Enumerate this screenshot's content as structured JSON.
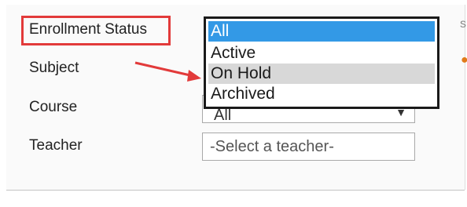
{
  "form": {
    "enrollment_status_label": "Enrollment Status",
    "subject_label": "Subject",
    "course_label": "Course",
    "teacher_label": "Teacher",
    "course_select_value": "All",
    "teacher_placeholder": "-Select a teacher-"
  },
  "dropdown": {
    "options": [
      "All",
      "Active",
      "On Hold",
      "Archived"
    ],
    "selected": "All",
    "hovered": "On Hold"
  },
  "annotation": {
    "highlight_color": "#e23a3a",
    "arrow_color": "#e23a3a"
  },
  "colors": {
    "selected_bg": "#3399e6",
    "hover_bg": "#d8d8d8"
  }
}
